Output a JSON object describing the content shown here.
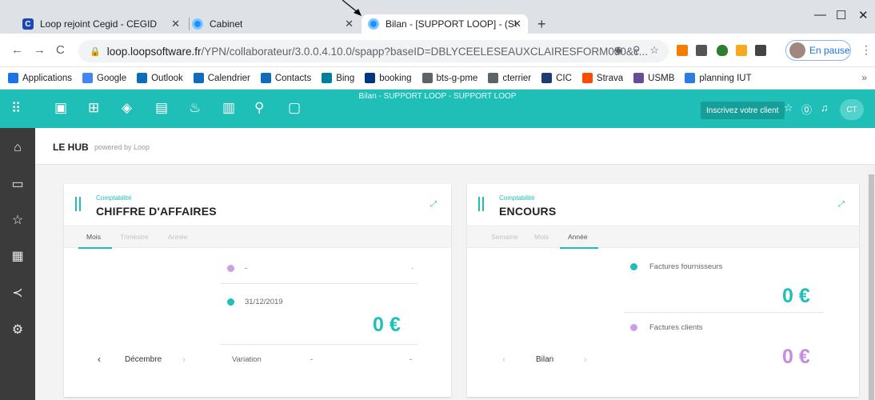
{
  "browser": {
    "tabs": [
      {
        "label": "Loop rejoint Cegid - CEGID",
        "favicon_text": "C",
        "favicon_color": "#1a47b8",
        "close": "✕"
      },
      {
        "label": "Cabinet",
        "close": "✕"
      },
      {
        "label": "Bilan - [SUPPORT LOOP] - (SUPP",
        "close": "✕",
        "active": true
      }
    ],
    "new_tab": "+",
    "window_controls": {
      "minimize": "—",
      "maximize": "☐",
      "close": "✕"
    },
    "nav": {
      "back": "←",
      "forward": "→",
      "reload": "C"
    },
    "address": {
      "host": "loop.loopsoftware.fr",
      "path": "/YPN/collaborateur/3.0.0.4.10.0/spapp?baseID=DBLYCEELESEAUXCLAIRESFORM050&c..."
    },
    "profile_status": "En pause",
    "menu": "⋮",
    "bookmarks": [
      {
        "label": "Applications",
        "icon": "apps-grid-icon",
        "color": "#1a73e8"
      },
      {
        "label": "Google",
        "icon": "google-icon",
        "color": "#4285f4"
      },
      {
        "label": "Outlook",
        "icon": "outlook-icon",
        "color": "#0f6cbd"
      },
      {
        "label": "Calendrier",
        "icon": "calendar-icon",
        "color": "#0f6cbd"
      },
      {
        "label": "Contacts",
        "icon": "contacts-icon",
        "color": "#0f6cbd"
      },
      {
        "label": "Bing",
        "icon": "bing-icon",
        "color": "#00809d"
      },
      {
        "label": "booking",
        "icon": "booking-icon",
        "color": "#003580"
      },
      {
        "label": "bts-g-pme",
        "icon": "globe-icon",
        "color": "#5f6368"
      },
      {
        "label": "cterrier",
        "icon": "globe-icon",
        "color": "#5f6368"
      },
      {
        "label": "CIC",
        "icon": "cic-icon",
        "color": "#1e3c72"
      },
      {
        "label": "Strava",
        "icon": "strava-icon",
        "color": "#fc4c02"
      },
      {
        "label": "USMB",
        "icon": "usmb-icon",
        "color": "#6a4c93"
      },
      {
        "label": "planning IUT",
        "icon": "planning-icon",
        "color": "#2a7de1"
      }
    ],
    "bookmarks_more": "»"
  },
  "app": {
    "title": "Bilan - SUPPORT LOOP - SUPPORT LOOP",
    "invite_label": "Inscrivez votre client",
    "user_initials": "CT",
    "accent_color": "#1fbfb8"
  },
  "hub": {
    "title": "LE HUB",
    "subtitle": "powered by Loop"
  },
  "card_ca": {
    "category": "Comptabilité",
    "title": "CHIFFRE D'AFFAIRES",
    "tabs": [
      "Mois",
      "Trimestre",
      "Année"
    ],
    "active_tab": "Mois",
    "row1_label": "-",
    "row1_value": "-",
    "row2_label": "31/12/2019",
    "amount": "0 €",
    "month": "Décembre",
    "variation_label": "Variation",
    "variation_value": "-",
    "variation_extra": "-"
  },
  "card_encours": {
    "category": "Comptabilité",
    "title": "ENCOURS",
    "tabs": [
      "Semaine",
      "Mois",
      "Année"
    ],
    "active_tab": "Année",
    "suppliers_label": "Factures fournisseurs",
    "suppliers_amount": "0 €",
    "clients_label": "Factures clients",
    "clients_amount": "0 €",
    "period": "Bilan"
  }
}
